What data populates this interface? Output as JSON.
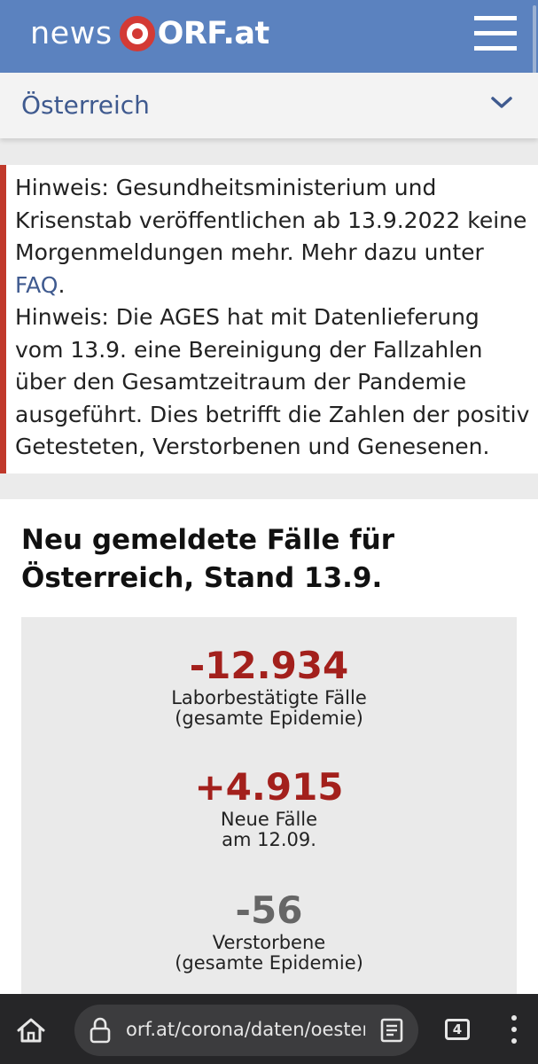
{
  "header": {
    "logo_news": "news",
    "logo_orf": "ORF.at",
    "menu_icon": "hamburger-menu-icon",
    "brand_color": "#5b82bf",
    "logo_red": "#d33a35"
  },
  "section": {
    "label": "Österreich",
    "dropdown_icon": "chevron-down-icon"
  },
  "notice": {
    "p1_before": "Hinweis: Gesundheitsministerium und Krisenstab veröffentlichen ab 13.9.2022 keine Morgenmeldungen mehr. Mehr dazu unter ",
    "p1_link": "FAQ",
    "p1_after": ".",
    "p2": "Hinweis: Die AGES hat mit Datenlieferung vom 13.9. eine Bereinigung der Fallzahlen über den Gesamtzeitraum der Pandemie ausgeführt. Dies betrifft die Zahlen der positiv Getesteten, Verstorbenen und Genesenen.",
    "accent_color": "#c0392b"
  },
  "card": {
    "title": "Neu gemeldete Fälle für Österreich, Stand 13.9.",
    "stats": [
      {
        "value": "-12.934",
        "label_line1": "Laborbestätigte Fälle",
        "label_line2": "(gesamte Epidemie)",
        "color": "#a3201c"
      },
      {
        "value": "+4.915",
        "label_line1": "Neue Fälle",
        "label_line2": "am 12.09.",
        "color": "#a3201c"
      },
      {
        "value": "-56",
        "label_line1": "Verstorbene",
        "label_line2": "(gesamte Epidemie)",
        "color": "#666666"
      }
    ]
  },
  "browser": {
    "url": "orf.at/corona/daten/oesterreich",
    "tab_count": "4",
    "home_icon": "home-icon",
    "lock_icon": "lock-icon",
    "reader_icon": "reader-mode-icon",
    "more_icon": "more-vert-icon"
  }
}
